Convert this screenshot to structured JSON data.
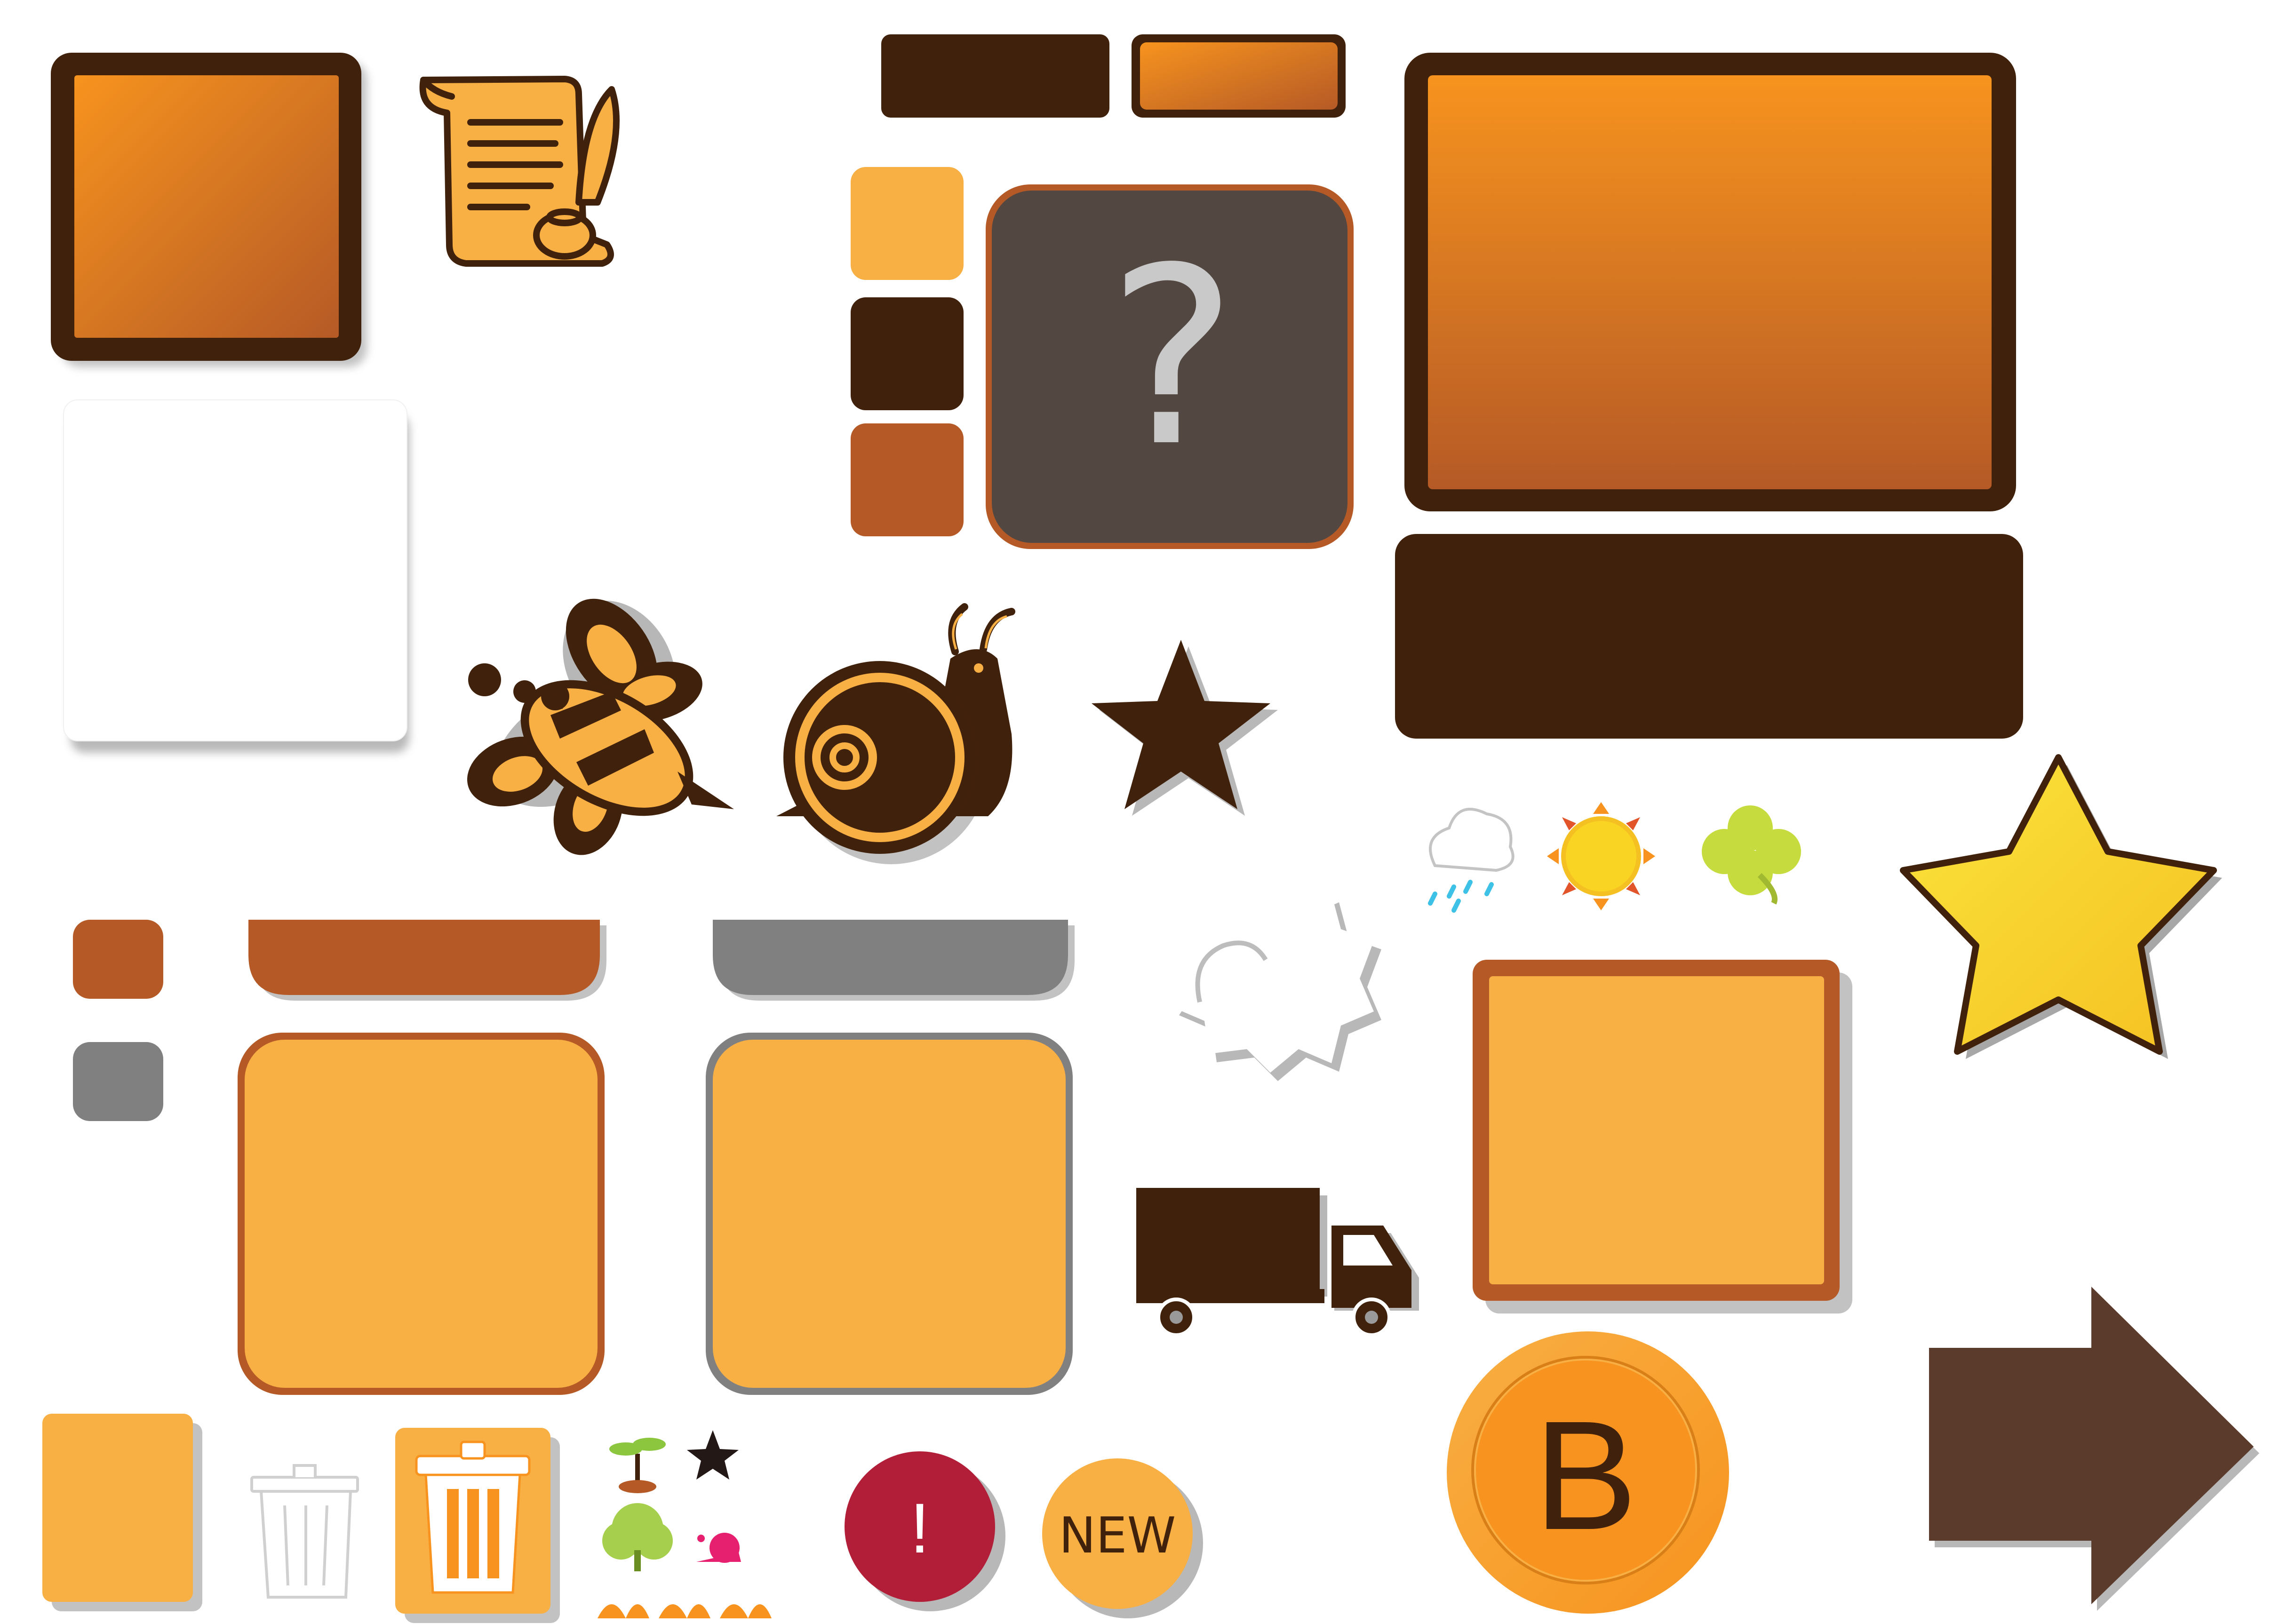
{
  "sheet": {
    "help_glyph": "?",
    "coin_letter": "B",
    "alert_glyph": "!",
    "new_badge": "NEW"
  },
  "icons": [
    "scroll-quill-icon",
    "help-icon",
    "bee-icon",
    "snail-icon",
    "star-icon",
    "weather-rain-icon",
    "sun-icon",
    "clover-icon",
    "gear-icon",
    "truck-icon",
    "trash-icon",
    "sprout-icon",
    "tree-icon",
    "arrow-right-icon",
    "grass-icon"
  ],
  "colors": {
    "dark_brown": "#40210C",
    "orange": "#F7931E",
    "light_orange": "#F8AF43",
    "rust": "#B55A26",
    "charcoal": "#534741",
    "gray": "#808080",
    "yellow": "#F9D423",
    "lime": "#C6DC3E",
    "crimson": "#B21E38",
    "arrow_brown": "#5A3B2C"
  }
}
